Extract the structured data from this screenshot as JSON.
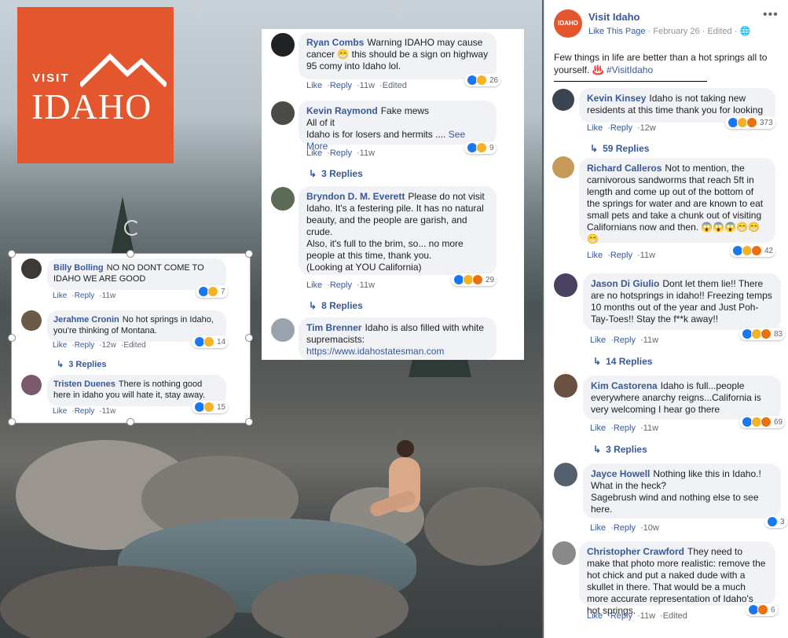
{
  "logo": {
    "line1": "VISIT",
    "line2": "IDAHO",
    "bg": "#e4572e"
  },
  "post": {
    "page_name": "Visit Idaho",
    "like_page": "Like This Page",
    "date": "February 26",
    "edited": "Edited",
    "text": "Few things in life are better than a hot springs all to yourself. ",
    "emoji": "♨️",
    "hashtag": "#VisitIdaho",
    "more_icon": "more-horizontal-icon",
    "globe_icon": "globe-icon"
  },
  "actions": {
    "like": "Like",
    "reply": "Reply"
  },
  "middle_comments": [
    {
      "name": "Ryan Combs",
      "text": "Warning IDAHO may cause cancer 😁 this should be a sign on highway 95 comy into Idaho lol.",
      "time": "11w",
      "edited": "Edited",
      "count": "26"
    },
    {
      "name": "Kevin Raymond",
      "text": "Fake mews\nAll of it\nIdaho is for losers and hermits ....",
      "see_more": "See More",
      "time": "11w",
      "count": "9",
      "replies": "3 Replies"
    },
    {
      "name": "Bryndon D. M. Everett",
      "text": "Please do not visit Idaho. It's a festering pile. It has no natural beauty, and the people are garish, and crude.\nAlso, it's full to the brim, so... no more people at this time, thank you.\n(Looking at YOU California)",
      "time": "11w",
      "count": "29",
      "replies": "8 Replies"
    },
    {
      "name": "Tim Brenner",
      "text": "Idaho is also filled with white supremacists:",
      "link": "https://www.idahostatesman.com"
    }
  ],
  "left_comments": [
    {
      "name": "Billy Bolling",
      "text": "NO NO DONT COME TO IDAHO WE ARE GOOD",
      "time": "11w",
      "count": "7"
    },
    {
      "name": "Jerahme Cronin",
      "text": "No hot springs in Idaho, you're thinking of Montana.",
      "time": "12w",
      "edited": "Edited",
      "count": "14",
      "replies": "3 Replies"
    },
    {
      "name": "Tristen Duenes",
      "text": "There is nothing good here in idaho you will hate it, stay away.",
      "time": "11w",
      "count": "15"
    }
  ],
  "right_comments": [
    {
      "name": "Kevin Kinsey",
      "text": "Idaho is not taking new residents at this time thank you for looking",
      "time": "12w",
      "count": "373",
      "replies": "59 Replies"
    },
    {
      "name": "Richard Calleros",
      "text": "Not to mention, the carnivorous sandworms that reach 5ft in length and come up out of the bottom of the springs for water and are known to eat small pets and take a chunk out of visiting Californians now and then. 😱😱😱😁😁 😁",
      "time": "11w",
      "count": "42"
    },
    {
      "name": "Jason Di Giulio",
      "text": "Dont let them lie!! There are no hotsprings in idaho!! Freezing temps 10 months out of the year and Just Poh-Tay-Toes!! Stay the f**k away!!",
      "time": "11w",
      "count": "83",
      "replies": "14 Replies"
    },
    {
      "name": "Kim Castorena",
      "text": "Idaho is full...people everywhere anarchy reigns...California is very welcoming I hear go there",
      "time": "11w",
      "count": "69",
      "replies": "3 Replies"
    },
    {
      "name": "Jayce Howell",
      "text": "Nothing like this in Idaho.! What in the heck?\nSagebrush wind and nothing else to see here.",
      "time": "10w",
      "count": "3"
    },
    {
      "name": "Christopher Crawford",
      "text": "They need to make that photo more realistic: remove the hot chick and put a naked dude with a skullet in there. That would be a much more accurate representation of Idaho's hot springs.",
      "time": "11w",
      "edited": "Edited",
      "count": "6"
    }
  ]
}
